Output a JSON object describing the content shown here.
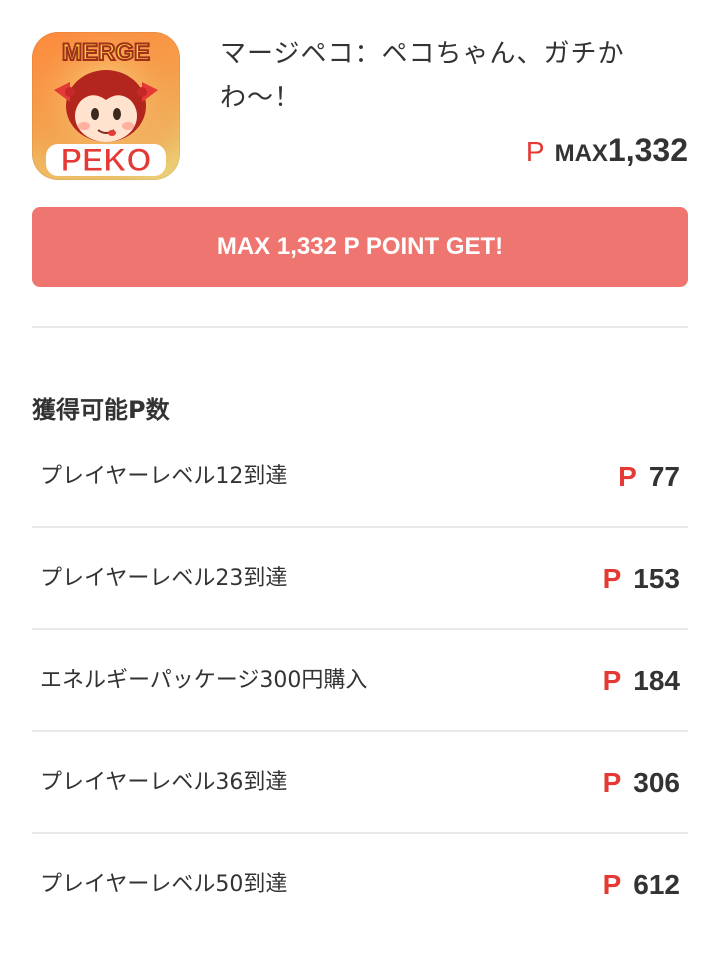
{
  "app": {
    "icon": "merge-peko-app-icon",
    "icon_text_top": "MERGE",
    "icon_text_bottom": "PEKO",
    "title": "マージペコ：ペコちゃん、ガチかわ〜！",
    "point_mark": "P",
    "max_label": "MAX",
    "max_value": "1,332"
  },
  "cta": {
    "label": "MAX 1,332 P POINT GET!",
    "color": "#ef7670"
  },
  "section": {
    "title": "獲得可能P数"
  },
  "tasks": [
    {
      "label": "プレイヤーレベル12到達",
      "point_mark": "P",
      "points": "77"
    },
    {
      "label": "プレイヤーレベル23到達",
      "point_mark": "P",
      "points": "153"
    },
    {
      "label": "エネルギーパッケージ300円購入",
      "point_mark": "P",
      "points": "184"
    },
    {
      "label": "プレイヤーレベル36到達",
      "point_mark": "P",
      "points": "306"
    },
    {
      "label": "プレイヤーレベル50到達",
      "point_mark": "P",
      "points": "612"
    }
  ],
  "colors": {
    "accent_red": "#e53935",
    "button": "#ef7670",
    "divider": "#e8e8e8"
  }
}
